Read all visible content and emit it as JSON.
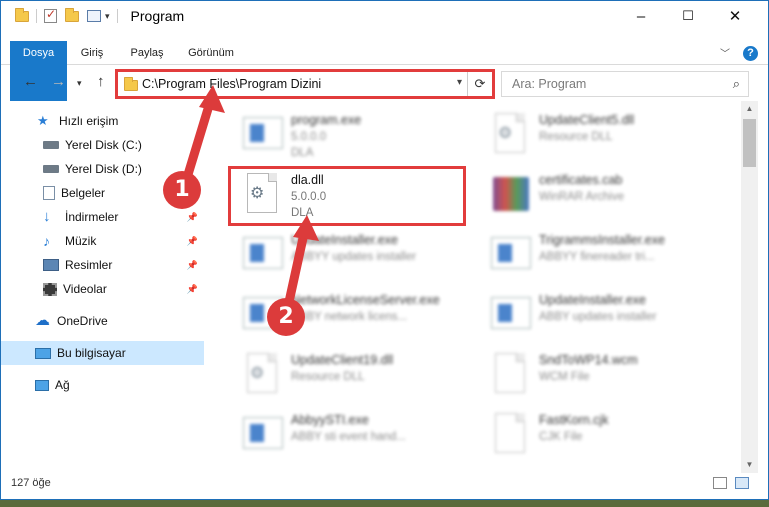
{
  "window": {
    "title": "Program",
    "controls": {
      "minimize": "–",
      "maximize": "☐",
      "close": "✕"
    }
  },
  "ribbon": {
    "tabs": [
      "Dosya",
      "Giriş",
      "Paylaş",
      "Görünüm"
    ],
    "help": "?"
  },
  "nav": {
    "address": "C:\\Program Files\\Program Dizini",
    "search_placeholder": "Ara: Program"
  },
  "sidebar": {
    "items": [
      {
        "label": "Hızlı erişim",
        "icon": "star-icon",
        "pinned": false
      },
      {
        "label": "Yerel Disk (C:)",
        "icon": "drive-icon",
        "pinned": false
      },
      {
        "label": "Yerel Disk (D:)",
        "icon": "drive-icon",
        "pinned": false
      },
      {
        "label": "Belgeler",
        "icon": "documents-icon",
        "pinned": true
      },
      {
        "label": "İndirmeler",
        "icon": "download-icon",
        "pinned": true
      },
      {
        "label": "Müzik",
        "icon": "music-icon",
        "pinned": true
      },
      {
        "label": "Resimler",
        "icon": "pictures-icon",
        "pinned": true
      },
      {
        "label": "Videolar",
        "icon": "video-icon",
        "pinned": true
      },
      {
        "label": "OneDrive",
        "icon": "cloud-icon",
        "pinned": false
      },
      {
        "label": "Bu bilgisayar",
        "icon": "computer-icon",
        "pinned": false,
        "selected": true
      },
      {
        "label": "Ağ",
        "icon": "network-icon",
        "pinned": false
      }
    ]
  },
  "files": [
    {
      "name": "program.exe",
      "line1": "5.0.0.0",
      "line2": "DLA",
      "icon": "app-icon",
      "blurred": true
    },
    {
      "name": "UpdateClient5.dll",
      "line1": "Resource DLL",
      "line2": "",
      "icon": "dll-icon",
      "blurred": true
    },
    {
      "name": "dla.dll",
      "line1": "5.0.0.0",
      "line2": "DLA",
      "icon": "dll-icon",
      "blurred": false,
      "highlighted": true
    },
    {
      "name": "certificates.cab",
      "line1": "WinRAR Archive",
      "line2": "",
      "icon": "winrar-icon",
      "blurred": true
    },
    {
      "name": "UpdateInstaller.exe",
      "line1": "ABBYY updates installer",
      "line2": "",
      "icon": "app-icon",
      "blurred": true
    },
    {
      "name": "TrigrammsInstaller.exe",
      "line1": "ABBYY finereader tri...",
      "line2": "",
      "icon": "app-icon",
      "blurred": true
    },
    {
      "name": "NetworkLicenseServer.exe",
      "line1": "ABBY network licens...",
      "line2": "",
      "icon": "app-icon",
      "blurred": true
    },
    {
      "name": "UpdateInstaller.exe",
      "line1": "ABBY updates installer",
      "line2": "",
      "icon": "app-icon",
      "blurred": true
    },
    {
      "name": "UpdateClient19.dll",
      "line1": "Resource DLL",
      "line2": "",
      "icon": "dll-icon",
      "blurred": true
    },
    {
      "name": "SndToWP14.wcm",
      "line1": "WCM File",
      "line2": "",
      "icon": "file-icon",
      "blurred": true
    },
    {
      "name": "AbbyySTI.exe",
      "line1": "ABBY sti event hand...",
      "line2": "",
      "icon": "app-icon",
      "blurred": true
    },
    {
      "name": "FastKorn.cjk",
      "line1": "CJK File",
      "line2": "",
      "icon": "file-icon",
      "blurred": true
    }
  ],
  "status": {
    "count": "127 öğe"
  },
  "annotations": {
    "badge1": "1",
    "badge2": "2"
  },
  "colors": {
    "accent": "#1979ca",
    "highlight": "#e23c3c",
    "selected": "#cce8ff"
  }
}
